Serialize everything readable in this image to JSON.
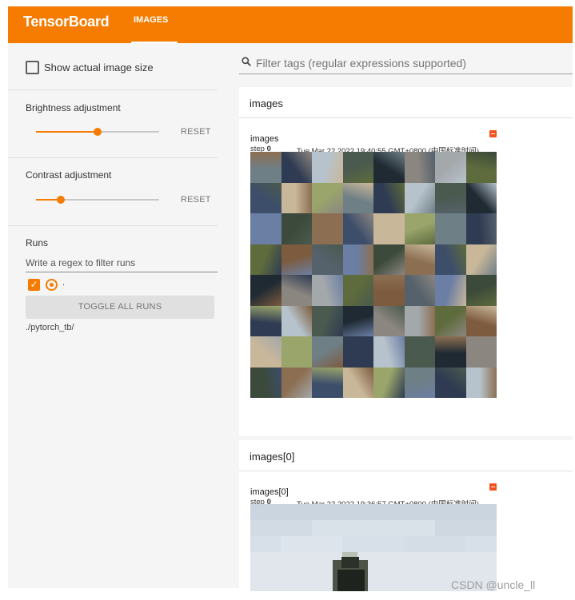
{
  "app": {
    "brand": "TensorBoard",
    "active_tab": "IMAGES"
  },
  "colors": {
    "accent": "#f57c00",
    "background": "#f5f5f5",
    "card": "#ffffff",
    "expand_icon": "#f4511e"
  },
  "sidebar": {
    "show_actual_size_label": "Show actual image size",
    "show_actual_size_checked": false,
    "brightness": {
      "label": "Brightness adjustment",
      "reset": "RESET",
      "level": 0.5
    },
    "contrast": {
      "label": "Contrast adjustment",
      "reset": "RESET",
      "level": 0.2
    },
    "runs": {
      "title": "Runs",
      "filter_placeholder": "Write a regex to filter runs",
      "run_name": ".",
      "run_checked": true,
      "toggle_all": "TOGGLE ALL RUNS",
      "path": "./pytorch_tb/"
    }
  },
  "main": {
    "filter_placeholder": "Filter tags (regular expressions supported)",
    "search_icon": "search-icon",
    "cards": [
      {
        "title": "images",
        "image_title": "images",
        "step_label": "step",
        "step_value": "0",
        "timestamp": "Tue Mar 22 2022 19:40:55 GMT+0800 (中国标准时间)",
        "grid": {
          "rows": 8,
          "cols": 8
        },
        "expand_icon": "expand-icon"
      },
      {
        "title": "images[0]",
        "image_title": "images[0]",
        "step_label": "step",
        "step_value": "0",
        "timestamp": "Tue Mar 22 2022 19:36:57 GMT+0800 (中国标准时间)",
        "expand_icon": "expand-icon"
      }
    ]
  },
  "watermark": "CSDN @uncle_ll"
}
